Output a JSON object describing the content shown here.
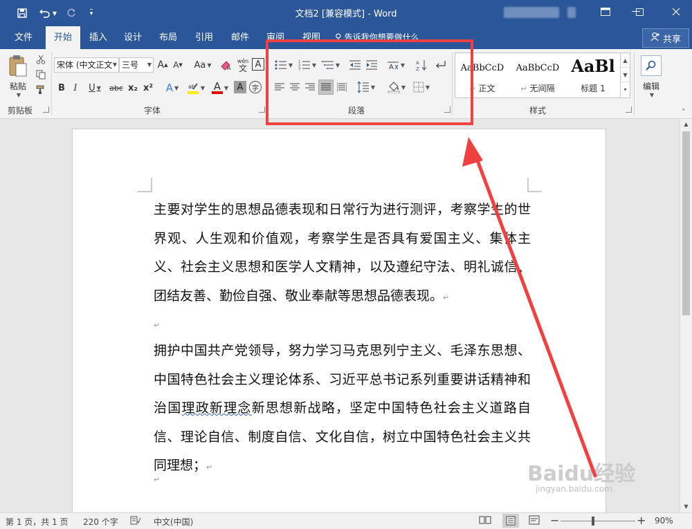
{
  "titlebar": {
    "title": "文档2 [兼容模式] - Word",
    "bg_color": "#2b579a",
    "quick_access": [
      "save-icon",
      "undo-icon",
      "redo-icon",
      "customize-icon"
    ],
    "window_buttons": [
      "restore-ribbon-icon",
      "minimize-icon",
      "maximize-icon",
      "close-icon"
    ]
  },
  "tabs": {
    "items": [
      "文件",
      "开始",
      "插入",
      "设计",
      "布局",
      "引用",
      "邮件",
      "审阅",
      "视图"
    ],
    "active": "开始",
    "tell_me": "告诉我你想要做什么",
    "share": "共享"
  },
  "ribbon": {
    "clipboard": {
      "label": "剪贴板",
      "paste": "粘贴"
    },
    "font": {
      "label": "字体",
      "font_name": "宋体 (中文正文",
      "font_size": "三号",
      "bold": "B",
      "italic": "I",
      "underline": "U",
      "strike": "abc",
      "subscript": "x₂",
      "superscript": "x²",
      "grow": "A",
      "shrink": "A",
      "change_case": "Aa",
      "char_border": "A",
      "font_color_letter": "A",
      "phonetic_top": "wén",
      "phonetic_bottom": "文",
      "char_shading": "A",
      "enclose": "字"
    },
    "paragraph": {
      "label": "段落"
    },
    "styles": {
      "label": "样式",
      "items": [
        {
          "sample": "AaBbCcD",
          "name": "正文"
        },
        {
          "sample": "AaBbCcD",
          "name": "无间隔"
        },
        {
          "sample": "AaBl",
          "name": "标题 1"
        }
      ]
    },
    "editing": {
      "label": "编辑"
    }
  },
  "document": {
    "paragraph1": "主要对学生的思想品德表现和日常行为进行测评，考察学生的世界观、人生观和价值观，考察学生是否具有爱国主义、集体主义、社会主义思想和医学人文精神，以及遵纪守法、明礼诚信、团结友善、勤俭自强、敬业奉献等思想品德表现。",
    "paragraph2_part1": "拥护中国共产党领导，努力学习马克思列宁主义、毛泽东思想、中国特色社会主义理论体系、习近平总书记系列重要讲话精神和治国",
    "paragraph2_squiggle": "理政新理念",
    "paragraph2_part2": "新思想新战略，坚定中国特色社会主义道路自信、理论自信、制度自信、文化自信，树立中国特色社会主义共同理想；",
    "return_mark": "↵"
  },
  "statusbar": {
    "page": "第 1 页，共 1 页",
    "words": "220 个字",
    "language": "中文(中国)",
    "zoom_minus": "−",
    "zoom_plus": "+",
    "zoom": "90%",
    "zoom_level": 0.9
  },
  "annotation": {
    "color": "#f04040"
  },
  "watermark": {
    "logo": "Baidu经验",
    "url": "jingyan.baidu.com"
  }
}
